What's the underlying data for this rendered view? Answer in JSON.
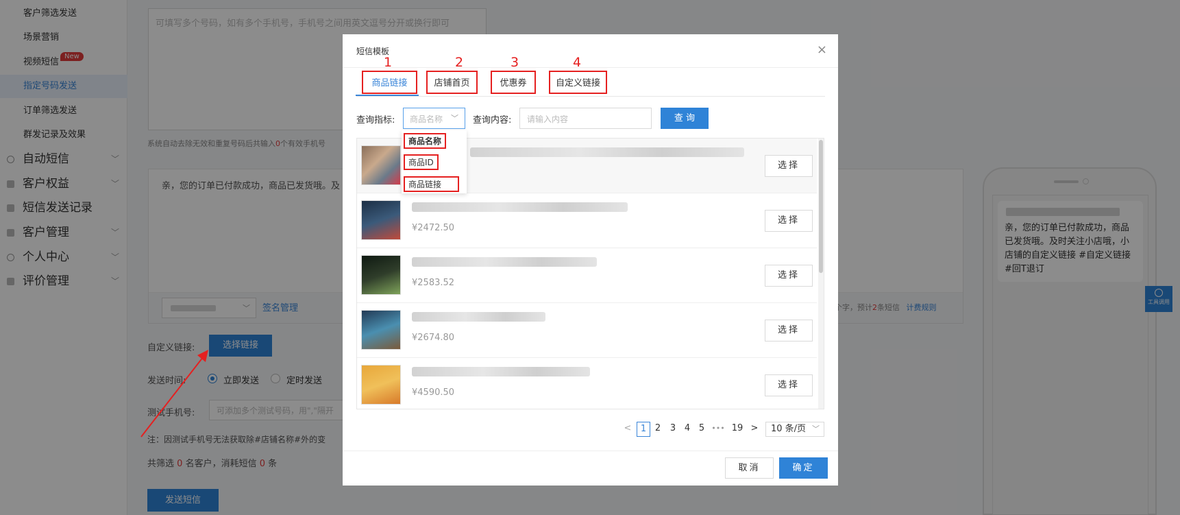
{
  "sidebar": {
    "sub_items": [
      {
        "label": "客户筛选发送"
      },
      {
        "label": "场景营销"
      },
      {
        "label": "视频短信",
        "badge": "New"
      },
      {
        "label": "指定号码发送"
      },
      {
        "label": "订单筛选发送"
      },
      {
        "label": "群发记录及效果"
      }
    ],
    "main_items": [
      {
        "label": "自动短信"
      },
      {
        "label": "客户权益"
      },
      {
        "label": "短信发送记录"
      },
      {
        "label": "客户管理"
      },
      {
        "label": "个人中心"
      },
      {
        "label": "评价管理"
      }
    ]
  },
  "page": {
    "phones_placeholder": "可填写多个号码，如有多个手机号，手机号之间用英文逗号分开或换行即可",
    "phones_hint_prefix": "系统自动去除无效和重复号码后共输入",
    "phones_hint_count": "0",
    "phones_hint_suffix": "个有效手机号",
    "content_text": "亲，您的订单已付款成功，商品已发货哦。及",
    "sig_mgmt": "签名管理",
    "count_a": "个字，预计",
    "count_num": "2",
    "count_b": "条短信",
    "billing_rule": "计费规则",
    "custom_link_label": "自定义链接:",
    "choose_link_btn": "选择链接",
    "send_time_label": "发送时间:",
    "send_now": "立即发送",
    "send_scheduled": "定时发送",
    "test_phone_label": "测试手机号:",
    "test_phone_placeholder": "可添加多个测试号码，用\",\"隔开",
    "note": "注：因测试手机号无法获取除#店铺名称#外的变",
    "summary_a": "共筛选",
    "summary_customers": "0",
    "summary_b": "名客户，消耗短信",
    "summary_sms": "0",
    "summary_c": "条",
    "send_btn": "发送短信"
  },
  "preview": {
    "message": "亲，您的订单已付款成功，商品已发货哦。及时关注小店哦，小店铺的自定义链接 #自定义链接 #回T退订",
    "float_label": "工具调用"
  },
  "modal": {
    "title": "短信模板",
    "tabs": [
      {
        "label": "商品链接",
        "num": "1"
      },
      {
        "label": "店铺首页",
        "num": "2"
      },
      {
        "label": "优惠券",
        "num": "3"
      },
      {
        "label": "自定义链接",
        "num": "4"
      }
    ],
    "query_label": "查询指标:",
    "query_select": "商品名称",
    "query_content_label": "查询内容:",
    "query_input_placeholder": "请输入内容",
    "query_btn": "查 询",
    "dropdown_options": [
      "商品名称",
      "商品ID",
      "商品链接"
    ],
    "products": [
      {
        "price": "",
        "select": "选择"
      },
      {
        "price": "¥2472.50",
        "select": "选择"
      },
      {
        "price": "¥2583.52",
        "select": "选择"
      },
      {
        "price": "¥2674.80",
        "select": "选择"
      },
      {
        "price": "¥4590.50",
        "select": "选择"
      }
    ],
    "pagination": {
      "pages": [
        "1",
        "2",
        "3",
        "4",
        "5",
        "•••",
        "19"
      ],
      "current": "1",
      "page_size": "10 条/页"
    },
    "cancel": "取消",
    "ok": "确定"
  },
  "colors": {
    "primary": "#2f83d7",
    "annotation_red": "#e52020",
    "active_nav_bg": "#e9f1fb"
  }
}
